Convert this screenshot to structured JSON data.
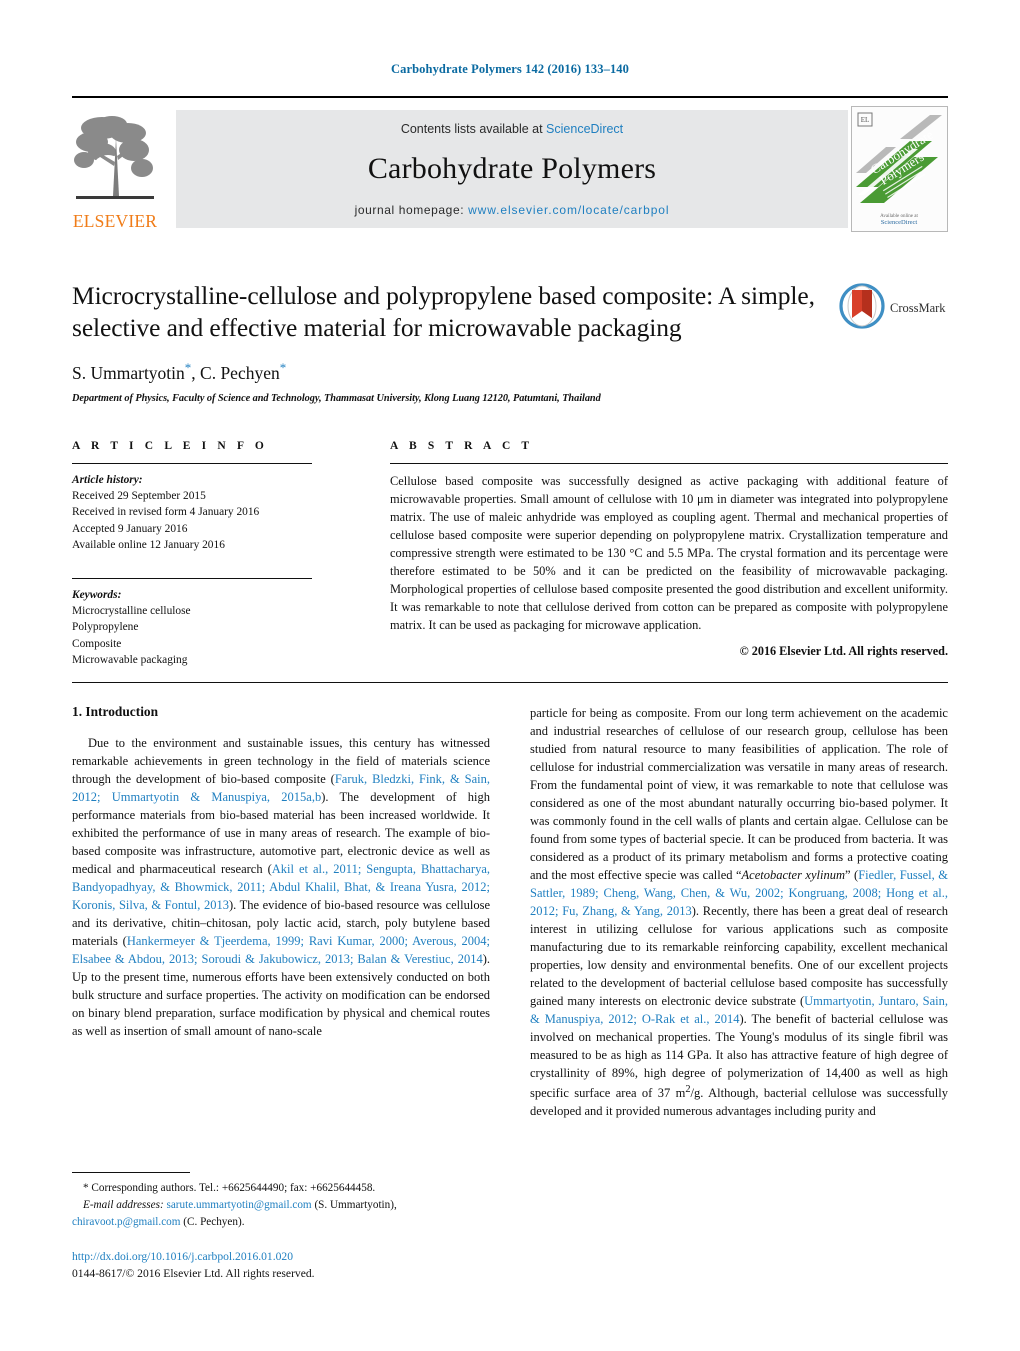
{
  "running_head": "Carbohydrate Polymers 142 (2016) 133–140",
  "masthead": {
    "publisher_wordmark": "ELSEVIER",
    "contents_prefix": "Contents lists available at ",
    "contents_link": "ScienceDirect",
    "journal_name": "Carbohydrate Polymers",
    "homepage_prefix": "journal homepage: ",
    "homepage_url": "www.elsevier.com/locate/carbpol",
    "cover_title_line1": "Carbohydrate",
    "cover_title_line2": "Polymers"
  },
  "title_block": {
    "title": "Microcrystalline-cellulose and polypropylene based composite: A simple, selective and effective material for microwavable packaging",
    "authors": "S. Ummartyotin, C. Pechyen",
    "author1": "S. Ummartyotin",
    "author2": "C. Pechyen",
    "affiliation": "Department of Physics, Faculty of Science and Technology, Thammasat University, Klong Luang 12120, Patumtani, Thailand",
    "crossmark_label": "CrossMark"
  },
  "article_info": {
    "heading": "A R T I C L E   I N F O",
    "history_label": "Article history:",
    "history": [
      "Received 29 September 2015",
      "Received in revised form 4 January 2016",
      "Accepted 9 January 2016",
      "Available online 12 January 2016"
    ],
    "keywords_label": "Keywords:",
    "keywords": [
      "Microcrystalline cellulose",
      "Polypropylene",
      "Composite",
      "Microwavable packaging"
    ]
  },
  "abstract": {
    "heading": "A B S T R A C T",
    "text": "Cellulose based composite was successfully designed as active packaging with additional feature of microwavable properties. Small amount of cellulose with 10 μm in diameter was integrated into polypropylene matrix. The use of maleic anhydride was employed as coupling agent. Thermal and mechanical properties of cellulose based composite were superior depending on polypropylene matrix. Crystallization temperature and compressive strength were estimated to be 130 °C and 5.5 MPa. The crystal formation and its percentage were therefore estimated to be 50% and it can be predicted on the feasibility of microwavable packaging. Morphological properties of cellulose based composite presented the good distribution and excellent uniformity. It was remarkable to note that cellulose derived from cotton can be prepared as composite with polypropylene matrix. It can be used as packaging for microwave application.",
    "copyright": "© 2016 Elsevier Ltd. All rights reserved."
  },
  "body": {
    "section_heading": "1. Introduction",
    "left_para_1_a": "Due to the environment and sustainable issues, this century has witnessed remarkable achievements in green technology in the field of materials science through the development of bio-based composite (",
    "left_cite_1": "Faruk, Bledzki, Fink, & Sain, 2012; Ummartyotin & Manuspiya, 2015a,b",
    "left_para_1_b": "). The development of high performance materials from bio-based material has been increased worldwide. It exhibited the performance of use in many areas of research. The example of bio-based composite was infrastructure, automotive part, electronic device as well as medical and pharmaceutical research (",
    "left_cite_2": "Akil et al., 2011; Sengupta, Bhattacharya, Bandyopadhyay, & Bhowmick, 2011; Abdul Khalil, Bhat, & Ireana Yusra, 2012; Koronis, Silva, & Fontul, 2013",
    "left_para_1_c": "). The evidence of bio-based resource was cellulose and its derivative, chitin–chitosan, poly lactic acid, starch, poly butylene based materials (",
    "left_cite_3": "Hankermeyer & Tjeerdema, 1999; Ravi Kumar, 2000; Averous, 2004; Elsabee & Abdou, 2013; Soroudi & Jakubowicz, 2013; Balan & Verestiuc, 2014",
    "left_para_1_d": "). Up to the present time, numerous efforts have been extensively conducted on both bulk structure and surface properties. The activity on modification can be endorsed on binary blend preparation, surface modification by physical and chemical routes as well as insertion of small amount of nano-scale",
    "right_para_a": "particle for being as composite. From our long term achievement on the academic and industrial researches of cellulose of our research group, cellulose has been studied from natural resource to many feasibilities of application. The role of cellulose for industrial commercialization was versatile in many areas of research. From the fundamental point of view, it was remarkable to note that cellulose was considered as one of the most abundant naturally occurring bio-based polymer. It was commonly found in the cell walls of plants and certain algae. Cellulose can be found from some types of bacterial specie. It can be produced from bacteria. It was considered as a product of its primary metabolism and forms a protective coating and the most effective specie was called “",
    "right_species": "Acetobacter xylinum",
    "right_para_b": "” (",
    "right_cite_1": "Fiedler, Fussel, & Sattler, 1989; Cheng, Wang, Chen, & Wu, 2002; Kongruang, 2008; Hong et al., 2012; Fu, Zhang, & Yang, 2013",
    "right_para_c": "). Recently, there has been a great deal of research interest in utilizing cellulose for various applications such as composite manufacturing due to its remarkable reinforcing capability, excellent mechanical properties, low density and environmental benefits. One of our excellent projects related to the development of bacterial cellulose based composite has successfully gained many interests on electronic device substrate (",
    "right_cite_2": "Ummartyotin, Juntaro, Sain, & Manuspiya, 2012; O-Rak et al., 2014",
    "right_para_d": "). The benefit of bacterial cellulose was involved on mechanical properties. The Young's modulus of its single fibril was measured to be as high as 114 GPa. It also has attractive feature of high degree of crystallinity of 89%, high degree of polymerization of 14,400 as well as high specific surface area of 37 m",
    "right_para_e": "/g. Although, bacterial cellulose was successfully developed and it provided numerous advantages including purity and",
    "superscript_2": "2"
  },
  "footnotes": {
    "corresponding": "* Corresponding authors. Tel.: +6625644490; fax: +6625644458.",
    "email_label": "E-mail addresses:",
    "email1": "sarute.ummartyotin@gmail.com",
    "email1_owner": " (S. Ummartyotin),",
    "email2": "chiravoot.p@gmail.com",
    "email2_owner": " (C. Pechyen).",
    "doi": "http://dx.doi.org/10.1016/j.carbpol.2016.01.020",
    "issn": "0144-8617/© 2016 Elsevier Ltd. All rights reserved."
  },
  "colors": {
    "link_blue": "#1f7fc0",
    "header_blue": "#0a6aa1",
    "elsevier_orange": "#f07c18",
    "banner_gray": "#e6e7e8",
    "cover_green": "#4a9b34"
  }
}
